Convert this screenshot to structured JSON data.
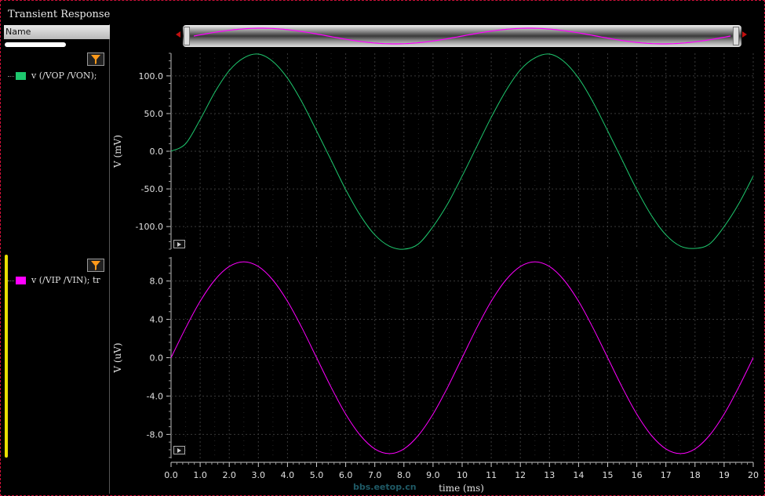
{
  "window": {
    "title": "Transient Response"
  },
  "left_panel": {
    "header": "Name",
    "legend": [
      {
        "label": "v (/VOP /VON);",
        "color": "#1ec86e"
      },
      {
        "label": "v (/VIP /VIN); tr",
        "color": "#ff00ff"
      }
    ]
  },
  "watermark": "bbs.eetop.cn",
  "colors": {
    "background": "#000000",
    "grid": "#3a3a3a",
    "trace_top": "#1ec86e",
    "trace_bottom": "#ff00ff",
    "frame": "#d0103a"
  },
  "chart_data": [
    {
      "type": "line",
      "title": "",
      "xlabel": "time (ms)",
      "ylabel": "V (mV)",
      "xlim": [
        0,
        20
      ],
      "ylim": [
        -130,
        130
      ],
      "y_ticks": [
        100.0,
        50.0,
        0.0,
        -50.0,
        -100.0
      ],
      "y_tick_labels": [
        "100.0",
        "50.0",
        "0.0",
        "-50.0",
        "-100.0"
      ],
      "series": [
        {
          "name": "v (/VOP /VON);",
          "color": "#1ec86e",
          "x": [
            0,
            0.5,
            1,
            1.5,
            2,
            2.5,
            3,
            3.5,
            4,
            4.5,
            5,
            5.5,
            6,
            6.5,
            7,
            7.5,
            8,
            8.5,
            9,
            9.5,
            10,
            10.5,
            11,
            11.5,
            12,
            12.5,
            13,
            13.5,
            14,
            14.5,
            15,
            15.5,
            16,
            16.5,
            17,
            17.5,
            18,
            18.5,
            19,
            19.5,
            20
          ],
          "y": [
            0,
            10,
            42,
            78,
            107,
            124,
            129,
            119,
            97,
            65,
            27,
            -12,
            -51,
            -85,
            -111,
            -126,
            -130,
            -123,
            -100,
            -70,
            -33,
            6,
            45,
            80,
            108,
            124,
            129,
            119,
            97,
            65,
            27,
            -12,
            -51,
            -85,
            -111,
            -126,
            -129,
            -123,
            -100,
            -70,
            -33
          ]
        }
      ],
      "grid": true
    },
    {
      "type": "line",
      "title": "",
      "xlabel": "time (ms)",
      "ylabel": "V (uV)",
      "xlim": [
        0,
        20
      ],
      "ylim": [
        -10.5,
        10.5
      ],
      "x_ticks": [
        0,
        1,
        2,
        3,
        4,
        5,
        6,
        7,
        8,
        9,
        10,
        11,
        12,
        13,
        14,
        15,
        16,
        17,
        18,
        19,
        20
      ],
      "x_tick_labels": [
        "0.0",
        "1.0",
        "2.0",
        "3.0",
        "4.0",
        "5.0",
        "6.0",
        "7.0",
        "8.0",
        "9.0",
        "10",
        "11",
        "12",
        "13",
        "14",
        "15",
        "16",
        "17",
        "18",
        "19",
        "20"
      ],
      "y_ticks": [
        8.0,
        4.0,
        0.0,
        -4.0,
        -8.0
      ],
      "y_tick_labels": [
        "8.0",
        "4.0",
        "0.0",
        "-4.0",
        "-8.0"
      ],
      "series": [
        {
          "name": "v (/VIP /VIN); tr",
          "color": "#ff00ff",
          "x": [
            0,
            0.5,
            1,
            1.5,
            2,
            2.5,
            3,
            3.5,
            4,
            4.5,
            5,
            5.5,
            6,
            6.5,
            7,
            7.5,
            8,
            8.5,
            9,
            9.5,
            10,
            10.5,
            11,
            11.5,
            12,
            12.5,
            13,
            13.5,
            14,
            14.5,
            15,
            15.5,
            16,
            16.5,
            17,
            17.5,
            18,
            18.5,
            19,
            19.5,
            20
          ],
          "y": [
            0,
            3.09,
            5.88,
            8.09,
            9.51,
            10.0,
            9.51,
            8.09,
            5.88,
            3.09,
            0,
            -3.09,
            -5.88,
            -8.09,
            -9.51,
            -10.0,
            -9.51,
            -8.09,
            -5.88,
            -3.09,
            0,
            3.09,
            5.88,
            8.09,
            9.51,
            10.0,
            9.51,
            8.09,
            5.88,
            3.09,
            0,
            -3.09,
            -5.88,
            -8.09,
            -9.51,
            -10.0,
            -9.51,
            -8.09,
            -5.88,
            -3.09,
            0
          ]
        }
      ],
      "grid": true
    }
  ]
}
